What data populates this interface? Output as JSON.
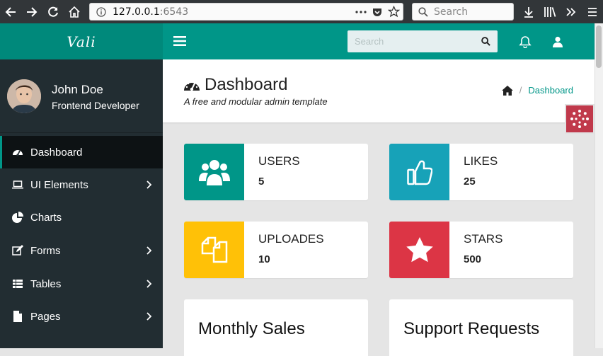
{
  "browser": {
    "url_host": "127.0.0.1",
    "url_port": ":6543",
    "search_placeholder": "Search"
  },
  "app": {
    "logo": "Vali",
    "search_placeholder": "Search"
  },
  "user": {
    "name": "John Doe",
    "role": "Frontend Developer"
  },
  "sidebar": {
    "items": [
      {
        "label": "Dashboard",
        "icon": "dashboard-icon"
      },
      {
        "label": "UI Elements",
        "icon": "laptop-icon"
      },
      {
        "label": "Charts",
        "icon": "pie-chart-icon"
      },
      {
        "label": "Forms",
        "icon": "edit-icon"
      },
      {
        "label": "Tables",
        "icon": "table-icon"
      },
      {
        "label": "Pages",
        "icon": "file-icon"
      }
    ]
  },
  "page": {
    "title": "Dashboard",
    "subtitle": "A free and modular admin template",
    "breadcrumb": "Dashboard"
  },
  "widgets": [
    {
      "label": "USERS",
      "value": "5",
      "color": "#009688"
    },
    {
      "label": "LIKES",
      "value": "25",
      "color": "#17a2b8"
    },
    {
      "label": "UPLOADES",
      "value": "10",
      "color": "#ffc107"
    },
    {
      "label": "STARS",
      "value": "500",
      "color": "#dc3545"
    }
  ],
  "tiles": [
    {
      "title": "Monthly Sales"
    },
    {
      "title": "Support Requests"
    }
  ]
}
